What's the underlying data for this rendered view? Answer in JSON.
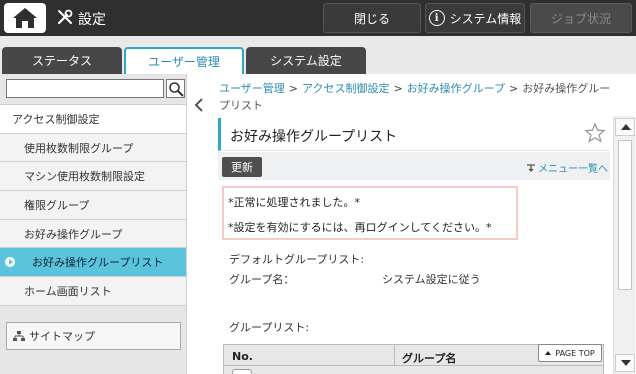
{
  "topbar": {
    "title": "設定",
    "close_label": "閉じる",
    "sysinfo_label": "システム情報",
    "job_label": "ジョブ状況"
  },
  "tabs": [
    {
      "label": "ステータス"
    },
    {
      "label": "ユーザー管理"
    },
    {
      "label": "システム設定"
    }
  ],
  "sidebar": {
    "search": {
      "value": "",
      "placeholder": ""
    },
    "items": [
      {
        "label": "アクセス制御設定"
      },
      {
        "label": "使用枚数制限グループ"
      },
      {
        "label": "マシン使用枚数制限設定"
      },
      {
        "label": "権限グループ"
      },
      {
        "label": "お好み操作グループ"
      },
      {
        "label": "お好み操作グループリスト"
      },
      {
        "label": "ホーム画面リスト"
      }
    ],
    "sitemap_label": "サイトマップ"
  },
  "breadcrumb": {
    "c1": "ユーザー管理",
    "c2": "アクセス制御設定",
    "c3": "お好み操作グループ",
    "c4": "お好み操作グループリスト",
    "sep": ">"
  },
  "page": {
    "title": "お好み操作グループリスト",
    "update_label": "更新",
    "menu_list_label": "メニュー一覧へ",
    "messages": {
      "m1": "*正常に処理されました。*",
      "m2": "*設定を有効にするには、再ログインしてください。*"
    },
    "default_group_label": "デフォルトグループリスト:",
    "group_name_label": "グループ名：",
    "group_name_value": "システム設定に従う",
    "group_list_label": "グループリスト:",
    "table": {
      "col_no": "No.",
      "col_name": "グループ名"
    },
    "page_top_label": "PAGE TOP"
  },
  "colors": {
    "accent": "#2fa8c9",
    "active_item": "#5ac4dd",
    "topbar": "#2f2f2f"
  }
}
